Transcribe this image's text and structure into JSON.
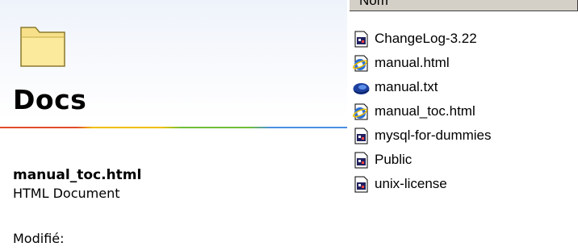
{
  "left_pane": {
    "folder_title": "Docs",
    "selected_file": {
      "name": "manual_toc.html",
      "type": "HTML Document",
      "modified_label": "Modifié:"
    }
  },
  "file_list": {
    "column_header": "Nom",
    "items": [
      {
        "name": "ChangeLog-3.22",
        "icon": "generic-file-icon"
      },
      {
        "name": "manual.html",
        "icon": "ie-document-icon"
      },
      {
        "name": "manual.txt",
        "icon": "netscape-document-icon"
      },
      {
        "name": "manual_toc.html",
        "icon": "ie-document-icon"
      },
      {
        "name": "mysql-for-dummies",
        "icon": "generic-file-icon"
      },
      {
        "name": "Public",
        "icon": "generic-file-icon"
      },
      {
        "name": "unix-license",
        "icon": "generic-file-icon"
      }
    ]
  },
  "colors": {
    "folder_yellow": "#f7e08a",
    "rainbow": [
      "#e04c2c",
      "#f0c000",
      "#6fbf3a",
      "#4a8fe0"
    ],
    "header_gray": "#d4d0c8"
  }
}
